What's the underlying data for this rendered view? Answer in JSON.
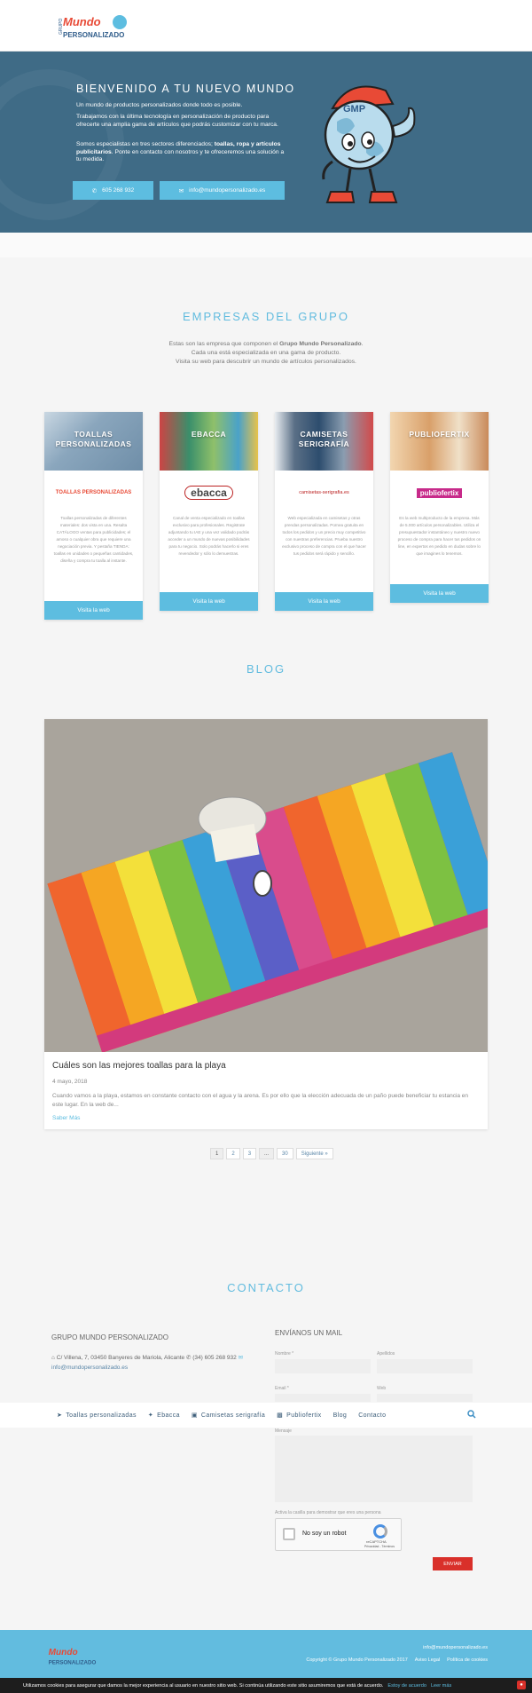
{
  "header": {
    "logo": {
      "group": "GRUPO",
      "line1": "Mundo",
      "line2": "PERSONALIZADO"
    }
  },
  "hero": {
    "title": "Bienvenido a tu nuevo mundo",
    "p1": "Un mundo de productos personalizados donde todo es posible.",
    "p2": "Trabajamos con la última tecnología en personalización de producto para ofrecerte una amplia gama de artículos que podrás customizar con tu marca.",
    "p3_start": "Somos especialistas en tres sectores diferenciados;",
    "p3_bold": "toallas, ropa y artículos publicitarios",
    "p3_end": ". Ponte en contacto con nosotros y te ofreceremos una solución a tu medida.",
    "phone": "605 268 932",
    "email": "info@mundopersonalizado.es",
    "mascot_text": "GMP"
  },
  "companies": {
    "title": "Empresas del grupo",
    "intro_start": "Estas son las empresa que componen el",
    "intro_bold": "Grupo Mundo Personalizado",
    "intro_line2": "Cada una está especializada en una gama de producto.",
    "intro_line3": "Visita su web para descubrir un mundo de artículos personalizados.",
    "cards": [
      {
        "title": "Toallas personalizadas",
        "logo": "TOALLAS PERSONALIZADAS",
        "text": "Toallas personalizadas de diferentes materiales: dos vista en una. Resalta CATÁLOGO ventas para publicidades; el amoso o cualquier obra que requiere una negociación previa. Y pestaña TIENDA: toallas en unidades o pequeñas cantidades, diseña y compra tu toalla al instante.",
        "button": "Visita la web",
        "color": "#9fb7c9"
      },
      {
        "title": "Ebacca",
        "logo": "ebacca",
        "text": "Canal de venta especializado en toallas exclusivo para profesionales. Registrate adjuntando tu IAE y una vez validado podrás acceder a un mundo de nuevas posibilidades para tu negocio. Solo podrás hacerlo si eres revendedor y sólo lo demuestras.",
        "button": "Visita la web",
        "color": "#5a9a86"
      },
      {
        "title": "Camisetas serigrafía",
        "logo": "camisetas-serigrafia.es",
        "text": "Web especializada en camisetas y otras prendas personalizadas. Pornea gratuita en todos los pedidos y un precio muy competitivo con nuestras preferencias. Prueba nuestro exclusivo proceso de compra con el que hacer tus pedidos será rápido y sencillo.",
        "button": "Visita la web",
        "color": "#5a6f86"
      },
      {
        "title": "Publiofertix",
        "logo": "publiofertix",
        "text": "Es la web multiproducto de la empresa. Más de 5.000 artículos personalizables. Utiliza el presupuestador instantáneo y nuestro nuevo proceso de compra para hacer tus pedidos on line, en expertos en pedido en dudas sobre lo que imagines lo tenemos.",
        "button": "Visita la web",
        "color": "#d9a06a"
      }
    ]
  },
  "blog": {
    "title": "Blog",
    "post": {
      "title": "Cuáles son las mejores toallas para la playa",
      "date": "4 mayo, 2018",
      "excerpt": "Cuando vamos a la playa, estamos en constante contacto con el agua y la arena. Es por ello que la elección adecuada de un paño puede beneficiar tu estancia en este lugar. En la web de...",
      "more": "Saber Más"
    },
    "pagination": [
      "1",
      "2",
      "3",
      "...",
      "30",
      "Siguiente »"
    ]
  },
  "contact": {
    "title": "Contacto",
    "company": "GRUPO MUNDO PERSONALIZADO",
    "address": "C/ Villena, 7, 03450 Banyeres de Mariola, Alicante",
    "phone": "(34) 605 268 932",
    "email": "info@mundopersonalizado.es",
    "form_title": "ENVÍANOS UN MAIL",
    "name_label": "Nombre *",
    "surname_label": "Apellidos",
    "email_label": "Email *",
    "web_label": "Web",
    "message_label": "Mensaje",
    "captcha_hint": "Activa la casilla para demostrar que eres una persona",
    "captcha_label": "No soy un robot",
    "captcha_brand": "reCAPTCHA",
    "captcha_links": "Privacidad - Términos",
    "send": "ENVIAR"
  },
  "nav": {
    "items": [
      "Toallas personalizadas",
      "Ebacca",
      "Camisetas serigrafía",
      "Publiofertix",
      "Blog",
      "Contacto"
    ]
  },
  "footer": {
    "email": "info@mundopersonalizado.es",
    "copyright": "Copyright © Grupo Mundo Personalizado 2017",
    "legal": "Aviso Legal",
    "cookies_policy": "Política de cookies"
  },
  "cookie": {
    "text": "Utilizamos cookies para asegurar que damos la mejor experiencia al usuario en nuestro sitio web. Si continúa utilizando este sitio asumiremos que está de acuerdo.",
    "accept": "Estoy de acuerdo",
    "read": "Leer más"
  }
}
